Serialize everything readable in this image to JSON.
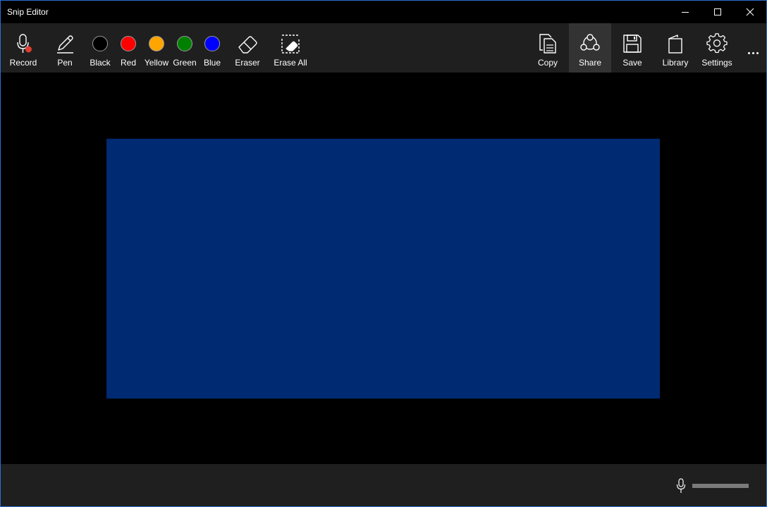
{
  "window": {
    "title": "Snip Editor"
  },
  "toolbar": {
    "left_tools": [
      {
        "id": "record",
        "label": "Record",
        "icon": "microphone-record-icon"
      },
      {
        "id": "pen",
        "label": "Pen",
        "icon": "pen-icon"
      },
      {
        "id": "black",
        "label": "Black",
        "color": "#000000"
      },
      {
        "id": "red",
        "label": "Red",
        "color": "#ff0000"
      },
      {
        "id": "yellow",
        "label": "Yellow",
        "color": "#ffa500"
      },
      {
        "id": "green",
        "label": "Green",
        "color": "#008000"
      },
      {
        "id": "blue",
        "label": "Blue",
        "color": "#0000ff"
      },
      {
        "id": "eraser",
        "label": "Eraser",
        "icon": "eraser-icon"
      },
      {
        "id": "erase_all",
        "label": "Erase All",
        "icon": "erase-all-icon"
      }
    ],
    "right_tools": [
      {
        "id": "copy",
        "label": "Copy",
        "icon": "copy-icon"
      },
      {
        "id": "share",
        "label": "Share",
        "icon": "share-icon",
        "active": true
      },
      {
        "id": "save",
        "label": "Save",
        "icon": "save-icon"
      },
      {
        "id": "library",
        "label": "Library",
        "icon": "library-icon"
      },
      {
        "id": "settings",
        "label": "Settings",
        "icon": "gear-icon"
      }
    ],
    "more_icon": "more-ellipsis-icon"
  },
  "canvas": {
    "snip_color": "#002a72",
    "background": "#000000"
  },
  "bottombar": {
    "mic_icon": "microphone-icon",
    "volume_color": "#7a7a7a"
  },
  "colors": {
    "toolbar_bg": "#1f1f1f",
    "active_tool_bg": "#333333",
    "window_border": "#2b6fd6",
    "record_dot": "#e03c31"
  }
}
